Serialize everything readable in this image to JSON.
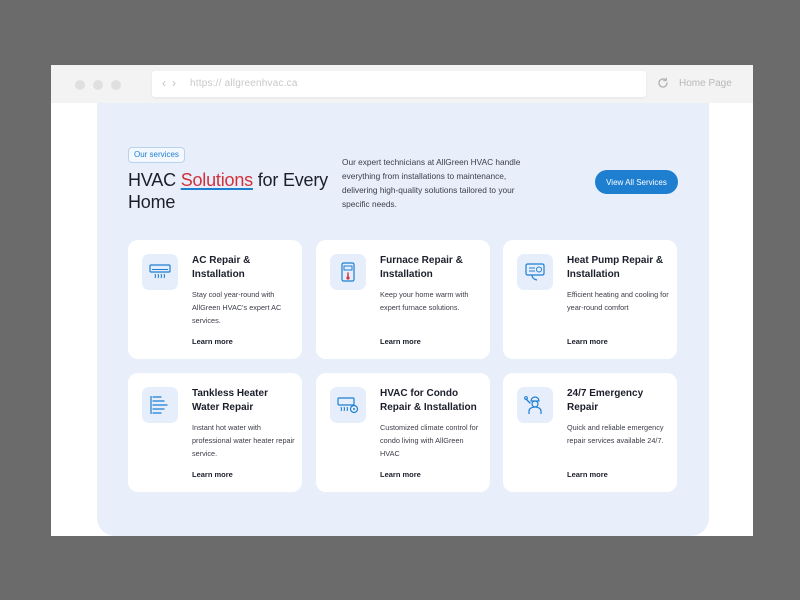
{
  "browser": {
    "url": "https:// allgreenhvac.ca",
    "nav_back": "‹",
    "nav_forward": "›",
    "home_label": "Home Page"
  },
  "section": {
    "badge": "Our services",
    "headline_prefix": "HVAC ",
    "headline_accent": "Solutions",
    "headline_suffix": " for Every Home",
    "intro": "Our expert technicians at AllGreen HVAC handle everything from installations to maintenance, delivering high-quality solutions tailored to your specific needs.",
    "cta": "View All Services"
  },
  "colors": {
    "accent_blue": "#1e7fd1",
    "accent_red": "#d1323a",
    "panel_bg": "#e8effb"
  },
  "services": [
    {
      "title": "AC Repair & Installation",
      "desc": "Stay cool year-round with AllGreen HVAC's expert AC services.",
      "link": "Learn more",
      "icon": "air-conditioner-icon"
    },
    {
      "title": "Furnace Repair & Installation",
      "desc": "Keep your home warm with expert furnace solutions.",
      "link": "Learn more",
      "icon": "furnace-icon"
    },
    {
      "title": "Heat Pump Repair & Installation",
      "desc": "Efficient heating and cooling for year-round comfort",
      "link": "Learn more",
      "icon": "heat-pump-icon"
    },
    {
      "title": "Tankless Heater Water Repair",
      "desc": "Instant hot water with professional water heater repair service.",
      "link": "Learn more",
      "icon": "water-heater-icon"
    },
    {
      "title": "HVAC for Condo Repair & Installation",
      "desc": "Customized climate control for condo living with AllGreen HVAC",
      "link": "Learn more",
      "icon": "condo-ac-icon"
    },
    {
      "title": "24/7 Emergency Repair",
      "desc": "Quick and reliable emergency repair services available 24/7.",
      "link": "Learn more",
      "icon": "technician-icon"
    }
  ]
}
